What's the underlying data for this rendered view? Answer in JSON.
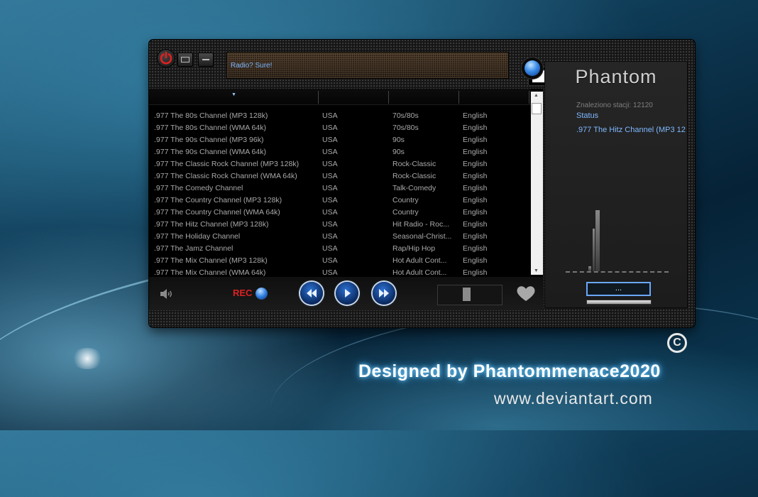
{
  "app": {
    "title": "Radio? Sure!",
    "logo": "Phantom"
  },
  "top_bar": {
    "power_icon": "power-icon",
    "restore_icon": "window-restore-icon",
    "minimize_icon": "window-minimize-icon",
    "dropdown_value": "",
    "globe_icon": "globe-icon"
  },
  "stations": [
    {
      "name": ".977 The 80s Channel (MP3 128k)",
      "country": "USA",
      "genre": "70s/80s",
      "language": "English"
    },
    {
      "name": ".977 The 80s Channel (WMA 64k)",
      "country": "USA",
      "genre": "70s/80s",
      "language": "English"
    },
    {
      "name": ".977 The 90s Channel (MP3 96k)",
      "country": "USA",
      "genre": "90s",
      "language": "English"
    },
    {
      "name": ".977 The 90s Channel (WMA 64k)",
      "country": "USA",
      "genre": "90s",
      "language": "English"
    },
    {
      "name": ".977 The Classic Rock Channel (MP3 128k)",
      "country": "USA",
      "genre": "Rock-Classic",
      "language": "English"
    },
    {
      "name": ".977 The Classic Rock Channel (WMA 64k)",
      "country": "USA",
      "genre": "Rock-Classic",
      "language": "English"
    },
    {
      "name": ".977 The Comedy Channel",
      "country": "USA",
      "genre": "Talk-Comedy",
      "language": "English"
    },
    {
      "name": ".977 The Country Channel (MP3 128k)",
      "country": "USA",
      "genre": "Country",
      "language": "English"
    },
    {
      "name": ".977 The Country Channel (WMA 64k)",
      "country": "USA",
      "genre": "Country",
      "language": "English"
    },
    {
      "name": ".977 The Hitz Channel (MP3 128k)",
      "country": "USA",
      "genre": "Hit Radio - Roc...",
      "language": "English"
    },
    {
      "name": ".977 The Holiday Channel",
      "country": "USA",
      "genre": "Seasonal-Christ...",
      "language": "English"
    },
    {
      "name": ".977 The Jamz Channel",
      "country": "USA",
      "genre": "Rap/Hip Hop",
      "language": "English"
    },
    {
      "name": ".977 The Mix Channel (MP3 128k)",
      "country": "USA",
      "genre": "Hot Adult Cont...",
      "language": "English"
    },
    {
      "name": ".977 The Mix Channel (WMA 64k)",
      "country": "USA",
      "genre": "Hot Adult Cont...",
      "language": "English"
    }
  ],
  "controls": {
    "volume_icon": "speaker-icon",
    "rec_label": "REC",
    "rec_icon": "record-orb-icon",
    "rewind_icon": "rewind-icon",
    "play_icon": "play-icon",
    "forward_icon": "fast-forward-icon",
    "favorite_icon": "heart-icon"
  },
  "side_panel": {
    "found_label": "Znaleziono stacji: 12120",
    "status_label": "Status",
    "current_station": ".977 The Hitz Channel (MP3 12",
    "more_button": "...",
    "eq_bars": [
      {
        "level": 0.06
      },
      {
        "level": 0.5
      },
      {
        "level": 0.72
      },
      {
        "level": 0.72
      }
    ]
  },
  "credits": {
    "copyright_symbol": "C",
    "designer": "Designed by Phantommenace2020",
    "website": "www.deviantart.com"
  },
  "colors": {
    "accent_blue": "#7fb8ff",
    "rec_red": "#dd2222",
    "glow": "#6fd0ff"
  }
}
